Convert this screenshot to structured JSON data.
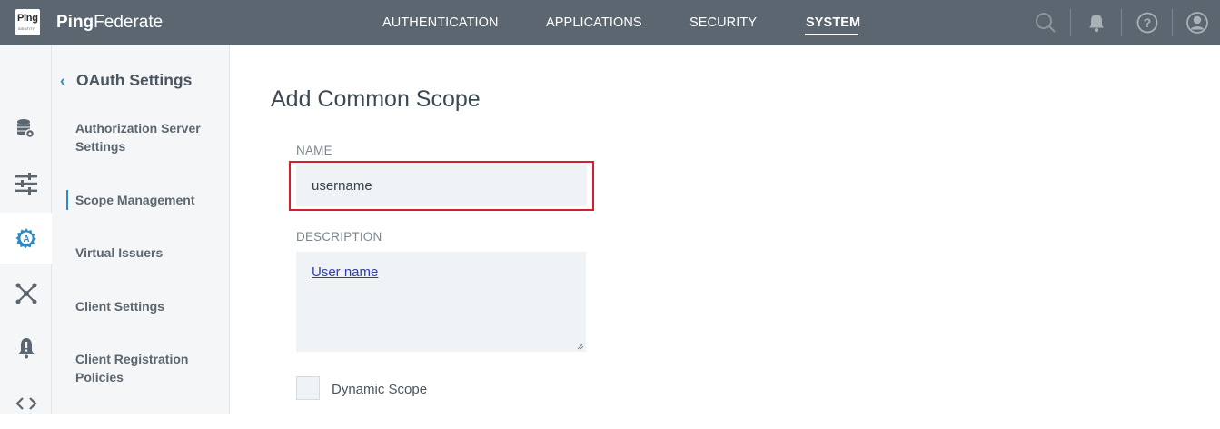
{
  "brand": {
    "logo_text": "Ping",
    "logo_sub": "IDENTITY",
    "name_bold": "Ping",
    "name_rest": "Federate"
  },
  "top_nav": [
    {
      "label": "AUTHENTICATION",
      "active": false
    },
    {
      "label": "APPLICATIONS",
      "active": false
    },
    {
      "label": "SECURITY",
      "active": false
    },
    {
      "label": "SYSTEM",
      "active": true
    }
  ],
  "top_icons": [
    "search-icon",
    "bell-icon",
    "help-icon",
    "user-icon"
  ],
  "rail_icons": [
    "data-stores-icon",
    "settings-sliders-icon",
    "oauth-gear-icon",
    "network-icon",
    "alerts-icon",
    "code-icon"
  ],
  "subnav": {
    "back_label": "OAuth Settings",
    "items": [
      {
        "label": "Authorization Server Settings"
      },
      {
        "label": "Scope Management",
        "active": true
      },
      {
        "label": "Virtual Issuers"
      },
      {
        "label": "Client Settings"
      },
      {
        "label": "Client Registration Policies"
      }
    ]
  },
  "main": {
    "title": "Add Common Scope",
    "name_label": "NAME",
    "name_value": "username",
    "description_label": "DESCRIPTION",
    "description_value": "User name",
    "dynamic_scope_label": "Dynamic Scope",
    "dynamic_scope_checked": false
  },
  "colors": {
    "topbar": "#5b6670",
    "accent": "#2c8ac7",
    "highlight": "#d2202f"
  }
}
